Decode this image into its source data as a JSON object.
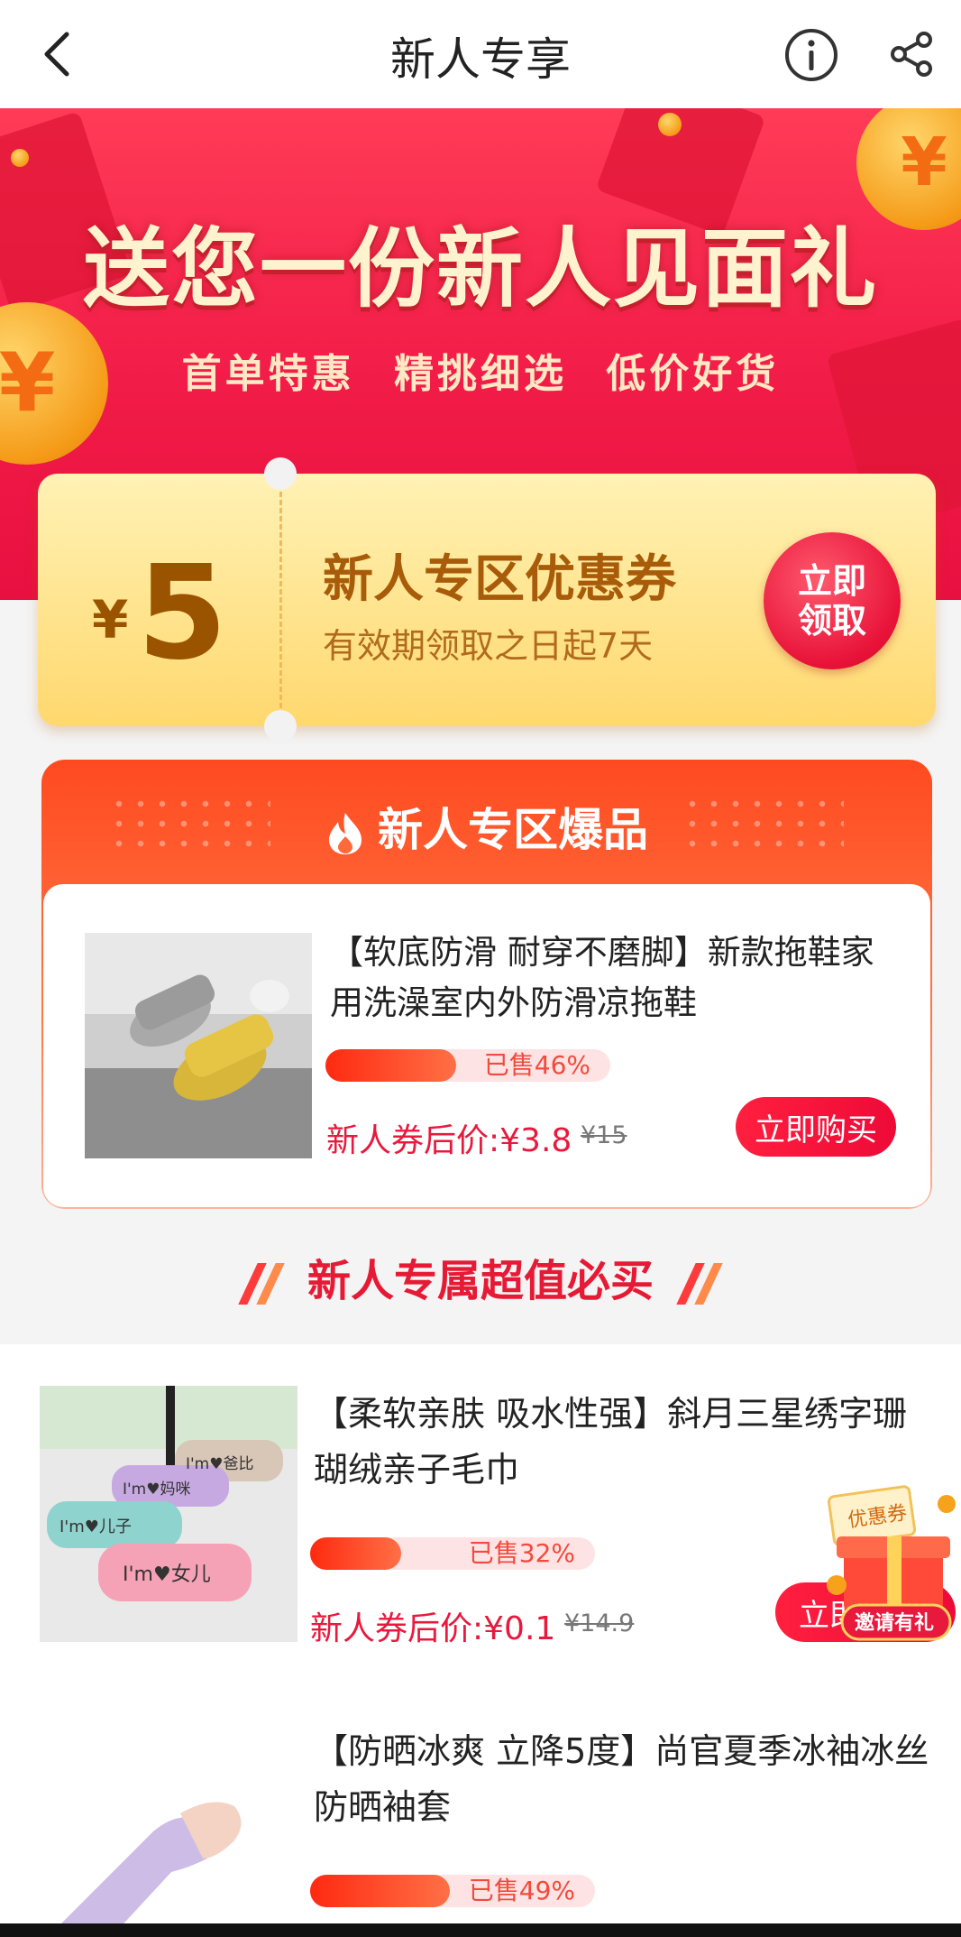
{
  "header": {
    "title": "新人专享"
  },
  "banner": {
    "headline": "送您一份新人见面礼",
    "subline": "首单特惠 精挑细选 低价好货"
  },
  "coupon": {
    "currency": "¥",
    "amount": "5",
    "title": "新人专区优惠券",
    "subtitle": "有效期领取之日起7天",
    "claim_line1": "立即",
    "claim_line2": "领取"
  },
  "hot_section": {
    "title": "新人专区爆品",
    "product": {
      "name": "【软底防滑 耐穿不磨脚】新款拖鞋家用洗澡室内外防滑凉拖鞋",
      "sold_label": "已售46%",
      "sold_fraction": 0.46,
      "price_label": "新人券后价:¥3.8",
      "original_price": "¥15",
      "buy_label": "立即购买"
    }
  },
  "value_section": {
    "title": "新人专属超值必买"
  },
  "products": [
    {
      "name": "【柔软亲肤 吸水性强】斜月三星绣字珊瑚绒亲子毛巾",
      "sold_label": "已售32%",
      "sold_fraction": 0.32,
      "price_label": "新人券后价:¥0.1",
      "original_price": "¥14.9",
      "buy_label": "立即购买",
      "towel_texts": [
        "I'm♥爸比",
        "I'm♥妈咪",
        "I'm♥儿子",
        "I'm♥女儿"
      ]
    },
    {
      "name": "【防晒冰爽 立降5度】尚官夏季冰袖冰丝防晒袖套",
      "sold_label": "已售49%",
      "sold_fraction": 0.49
    }
  ],
  "float_widget": {
    "coupon_text": "优惠券",
    "invite_text": "邀请有礼"
  },
  "colors": {
    "accent": "#e8193d",
    "coupon": "#ffd86e",
    "banner": "#f21c48"
  }
}
